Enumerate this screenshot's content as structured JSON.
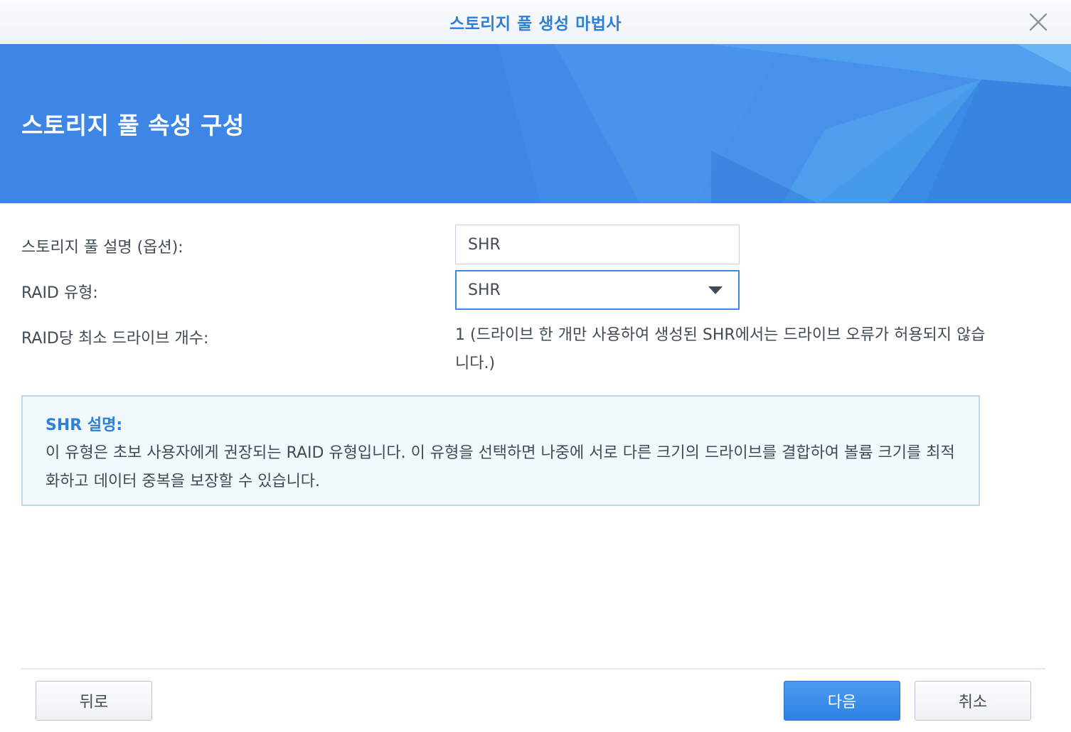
{
  "window": {
    "title": "스토리지 풀 생성 마법사",
    "close_icon": "close-icon"
  },
  "banner": {
    "title": "스토리지 풀 속성 구성",
    "color": "#3e86e6"
  },
  "form": {
    "description_label": "스토리지 풀 설명 (옵션):",
    "description_value": "SHR",
    "raid_type_label": "RAID 유형:",
    "raid_type_value": "SHR",
    "min_drives_label": "RAID당 최소 드라이브 개수:",
    "min_drives_value": "1 (드라이브 한 개만 사용하여 생성된 SHR에서는 드라이브 오류가 허용되지 않습니다.)"
  },
  "info": {
    "title": "SHR 설명:",
    "text": "이 유형은 초보 사용자에게 권장되는 RAID 유형입니다. 이 유형을 선택하면 나중에 서로 다른 크기의 드라이브를 결합하여 볼륨 크기를 최적화하고 데이터 중복을 보장할 수 있습니다."
  },
  "footer": {
    "back_label": "뒤로",
    "next_label": "다음",
    "cancel_label": "취소"
  },
  "colors": {
    "accent": "#2d7fd7",
    "primary_button": "#3a8ae8",
    "info_border": "#bcd8ee",
    "info_background": "#f2f9fd"
  }
}
